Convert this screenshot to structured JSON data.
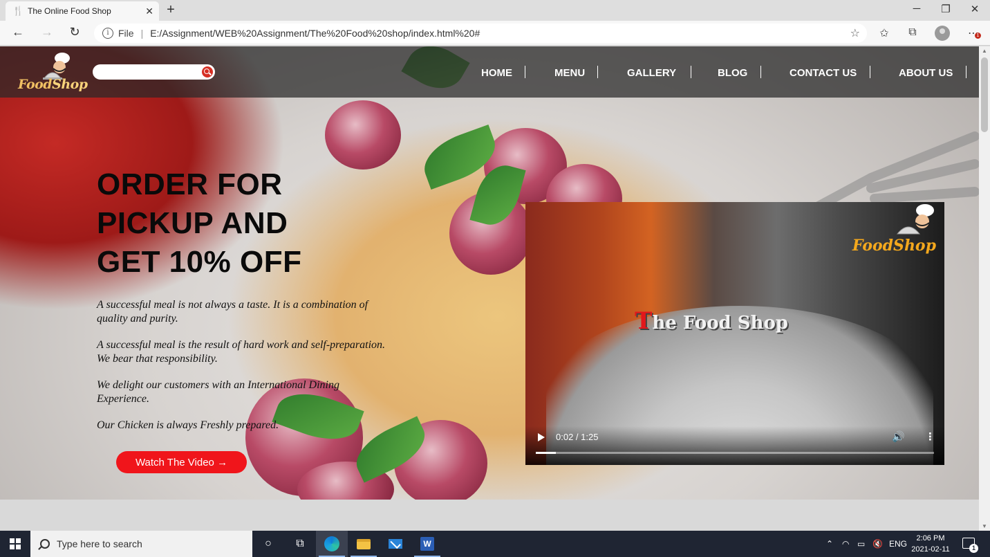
{
  "browser": {
    "tab_title": "The Online Food Shop",
    "tab_close": "✕",
    "new_tab": "+",
    "address_prefix": "File",
    "address_separator": "|",
    "url": "E:/Assignment/WEB%20Assignment/The%20Food%20shop/index.html%20#",
    "notification_count": "1"
  },
  "site": {
    "logo_text_a": "Food",
    "logo_text_b": "Shop",
    "search_placeholder": "",
    "nav": [
      {
        "label": "HOME"
      },
      {
        "label": "MENU"
      },
      {
        "label": "GALLERY"
      },
      {
        "label": "BLOG"
      },
      {
        "label": "CONTACT US"
      },
      {
        "label": "ABOUT US"
      }
    ],
    "headline": [
      "ORDER FOR",
      "PICKUP AND",
      "GET 10% OFF"
    ],
    "paragraphs": [
      "A successful meal is not always a taste. It is a combination of quality and purity.",
      "A successful meal is the result of hard work and self-preparation. We bear that responsibility.",
      "We delight our customers with an International Dining Experience.",
      "Our Chicken is always Freshly prepared."
    ],
    "cta": "Watch The Video →",
    "video": {
      "title_first": "T",
      "title_rest": "he Food Shop",
      "logo_text": "FoodShop",
      "time": "0:02 / 1:25",
      "progress": 0.05
    }
  },
  "taskbar": {
    "search_placeholder": "Type here to search",
    "lang": "ENG",
    "time": "2:06 PM",
    "date": "2021-02-11",
    "notifications": "1",
    "word_letter": "W"
  },
  "colors": {
    "accent_red": "#f0151b",
    "nav_bg": "#282828",
    "logo_orange": "#f4a81d",
    "taskbar": "#1f2533"
  }
}
